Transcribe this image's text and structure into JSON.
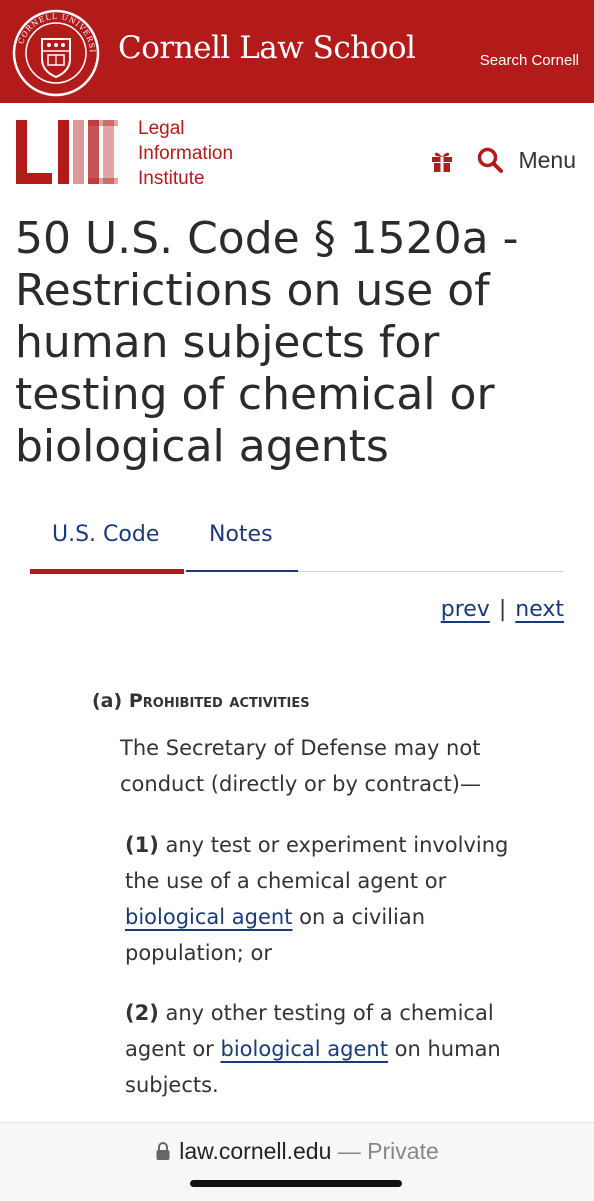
{
  "cornell_header": {
    "title": "Cornell Law School",
    "search_label": "Search Cornell",
    "seal_text": "CORNELL UNIVERSITY FOUNDED A.D. 1865",
    "brand_color": "#b31b1b"
  },
  "lii_header": {
    "logo_text": "LII",
    "name_lines": [
      "Legal",
      "Information",
      "Institute"
    ],
    "gift_icon": "gift-icon",
    "search_icon": "search-icon",
    "menu_label": "Menu"
  },
  "page": {
    "title": "50 U.S. Code § 1520a - Restrictions on use of human subjects for testing of chemical or biological agents"
  },
  "tabs": [
    {
      "label": "U.S. Code",
      "active": true
    },
    {
      "label": "Notes",
      "active": false
    }
  ],
  "pager": {
    "prev_label": "prev",
    "separator": "|",
    "next_label": "next"
  },
  "content": {
    "section_a": {
      "marker": "(a)",
      "heading": "Prohibited activities",
      "intro": "The Secretary of Defense may not conduct (directly or by contract)—",
      "item_1": {
        "marker": "(1)",
        "text_before": "any test or experiment involving the use of a chemical agent or",
        "link": "biological agent",
        "text_after": "on a civilian population; or"
      },
      "item_2": {
        "marker": "(2)",
        "text_before": "any other testing of a chemical agent or",
        "link": "biological agent",
        "text_after": "on human subjects."
      }
    }
  },
  "browser": {
    "lock_icon": "lock-icon",
    "host": "law.cornell.edu",
    "suffix": "— Private"
  }
}
